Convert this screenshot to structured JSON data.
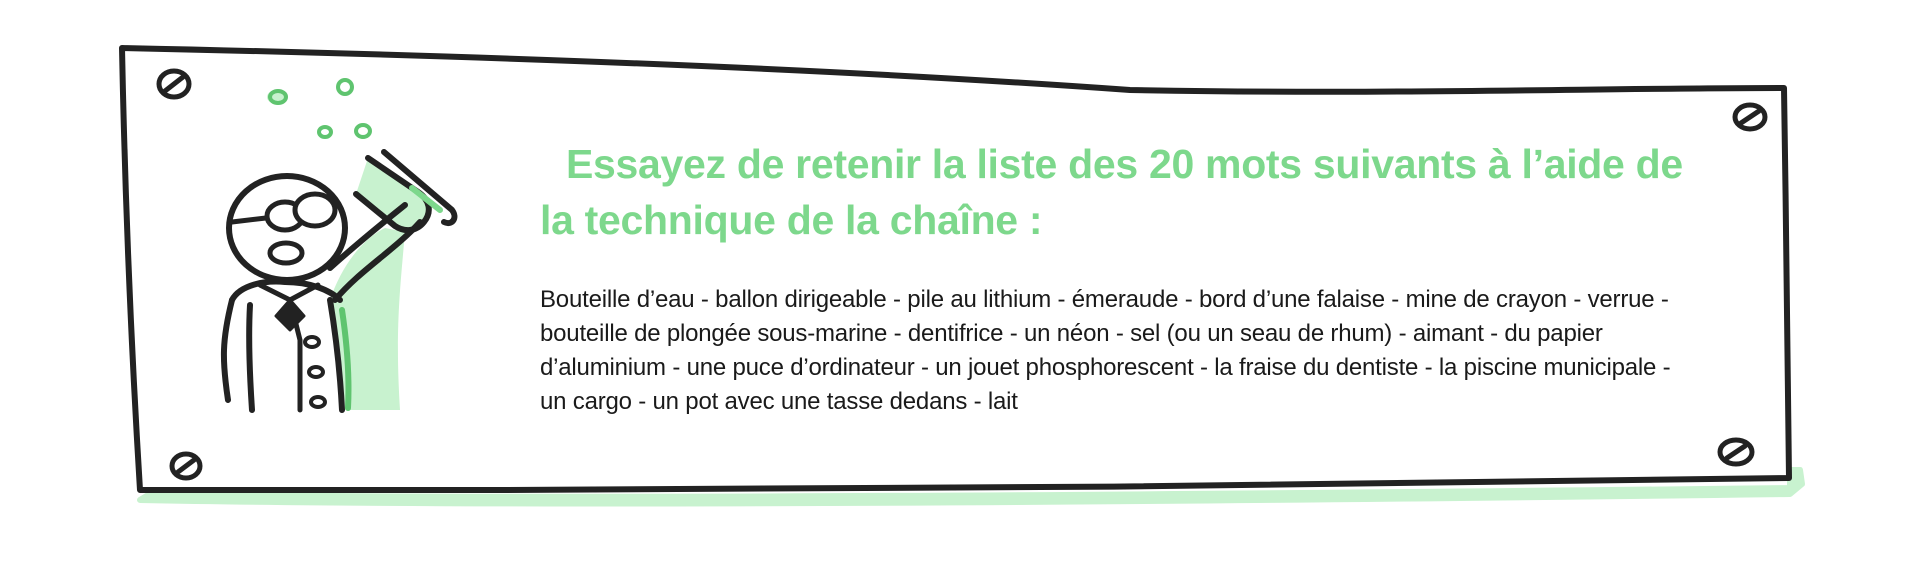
{
  "heading": "Essayez de retenir la liste des 20 mots suivants à l’aide de la technique de la chaîne :",
  "word_list": "Bouteille d’eau - ballon dirigeable - pile au lithium - émeraude - bord d’une falaise - mine de crayon - verrue - bouteille de plongée sous-marine - dentifrice - un néon - sel (ou un seau de rhum) - aimant  - du papier d’aluminium - une puce d’ordinateur - un jouet phosphorescent - la fraise du dentiste - la piscine municipale - un cargo - un pot avec une tasse dedans - lait",
  "colors": {
    "accent": "#7dd88c",
    "shadow": "#c8f2cf",
    "ink": "#222222",
    "text": "#1a1a1a"
  },
  "icons": {
    "illustration": "scientist-with-test-tube-icon",
    "screws": "screw-icon"
  }
}
